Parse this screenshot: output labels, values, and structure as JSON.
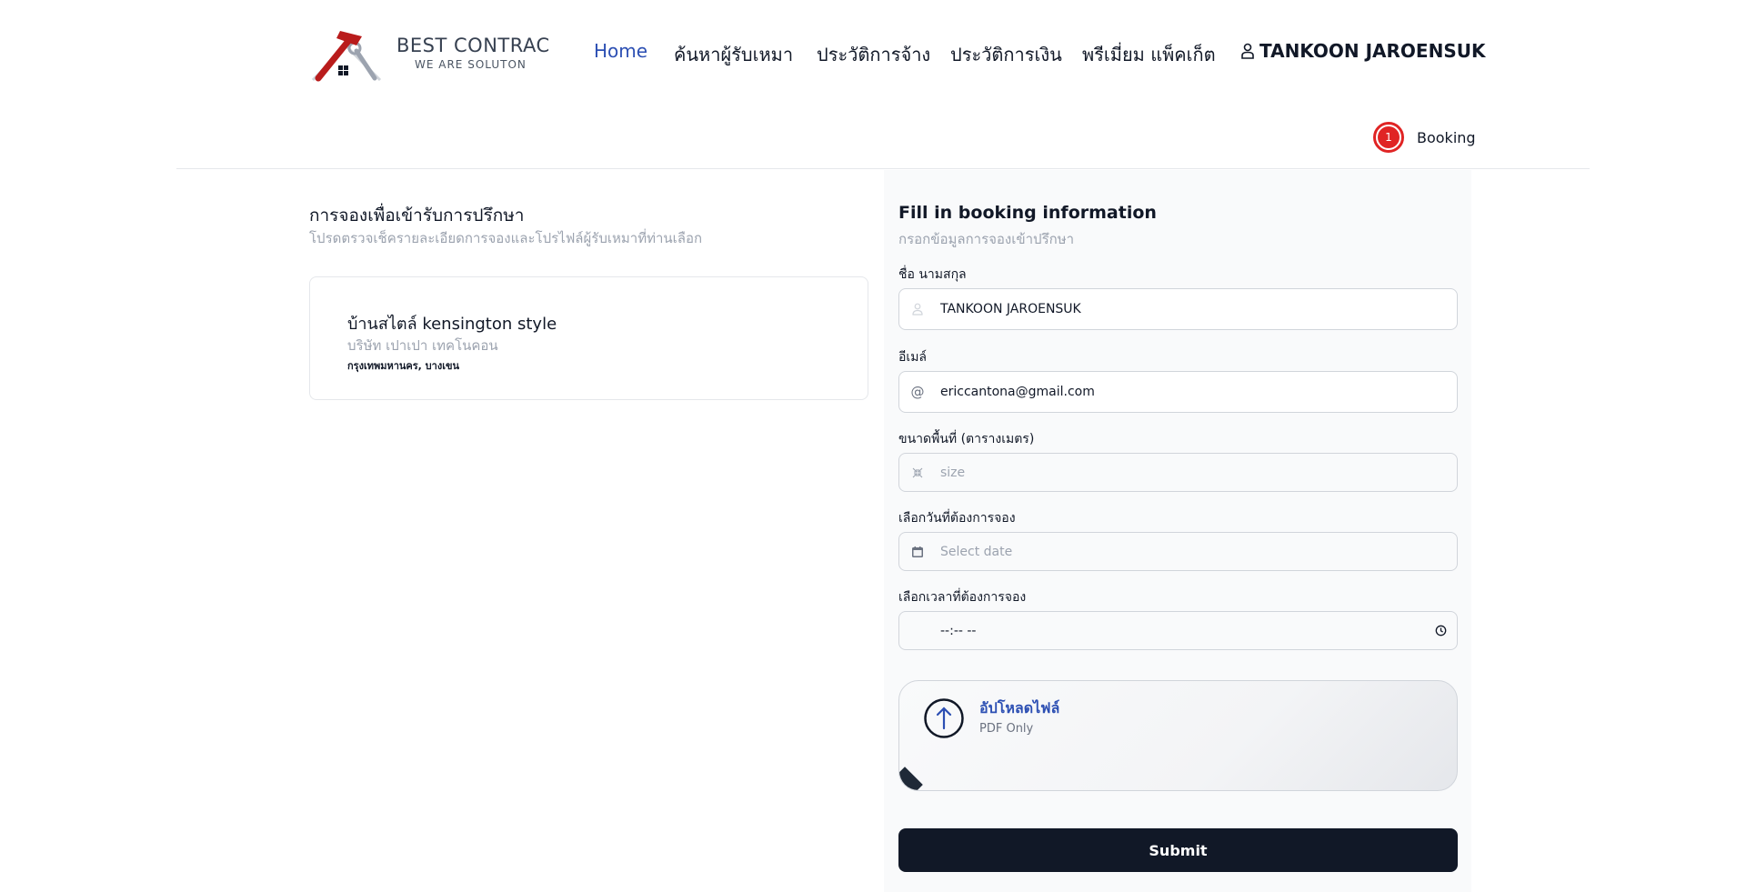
{
  "brand": {
    "title": "BEST CONTRAC",
    "tagline": "WE ARE SOLUTON",
    "colors": {
      "hammer": "#b91c1c",
      "nav_active": "#2c4fb3",
      "step_active": "#e02424",
      "submit_bg": "#111827"
    }
  },
  "nav": {
    "items": [
      {
        "label": "Home",
        "active": true
      },
      {
        "label": "ค้นหาผู้รับเหมา",
        "active": false
      },
      {
        "label": "ประวัติการจ้าง",
        "active": false
      },
      {
        "label": "ประวัติการเงิน",
        "active": false
      },
      {
        "label": "พรีเมี่ยม แพ็คเก็ต",
        "active": false
      }
    ],
    "user_name": "TANKOON JAROENSUK",
    "user_icon": "user-icon"
  },
  "steps": [
    {
      "number": "1",
      "label": "Booking",
      "active": true
    }
  ],
  "left": {
    "title": "การจองเพื่อเข้ารับการปรึกษา",
    "subtitle": "โปรดตรวจเช็ครายละเอียดการจองและโปรไฟล์ผู้รับเหมาที่ท่านเลือก",
    "card": {
      "name": "บ้านสไตล์ kensington style",
      "company": "บริษัท เปาเปา เทคโนคอน",
      "location": "กรุงเทพมหานคร, บางเขน"
    }
  },
  "form": {
    "title": "Fill in booking information",
    "subtitle": "กรอกข้อมูลการจองเข้าปรึกษา",
    "name": {
      "label": "ชื่อ นามสกุล",
      "value": "TANKOON JAROENSUK",
      "icon": "user-icon"
    },
    "email": {
      "label": "อีเมล์",
      "value": "ericcantona@gmail.com",
      "icon": "at-icon"
    },
    "size": {
      "label": "ขนาดพื้นที่ (ตารางเมตร)",
      "placeholder": "size",
      "icon": "shrink-icon"
    },
    "date": {
      "label": "เลือกวันที่ต้องการจอง",
      "placeholder": "Select date",
      "icon": "calendar-icon"
    },
    "time": {
      "label": "เลือกเวลาที่ต้องการจอง",
      "value": "--:-- --",
      "icon": "clock-icon"
    },
    "upload": {
      "title": "อัปโหลดไฟล์",
      "subtitle": "PDF Only",
      "icon": "upload-arrow-icon"
    },
    "submit_label": "Submit"
  }
}
